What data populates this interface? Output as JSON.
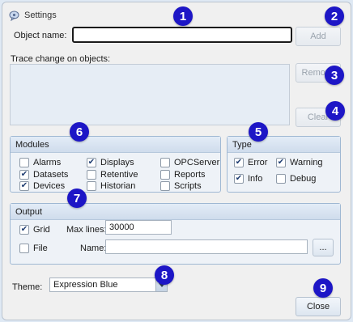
{
  "window": {
    "title": "Settings"
  },
  "object_name": {
    "label": "Object name:",
    "value": "",
    "add_label": "Add"
  },
  "trace": {
    "label": "Trace change on objects:",
    "remove_label": "Remove",
    "clear_label": "Clear"
  },
  "modules": {
    "title": "Modules",
    "items": [
      {
        "label": "Alarms",
        "checked": false
      },
      {
        "label": "Datasets",
        "checked": true
      },
      {
        "label": "Devices",
        "checked": true
      },
      {
        "label": "Displays",
        "checked": true
      },
      {
        "label": "Retentive",
        "checked": false
      },
      {
        "label": "Historian",
        "checked": false
      },
      {
        "label": "OPCServer",
        "checked": false
      },
      {
        "label": "Reports",
        "checked": false
      },
      {
        "label": "Scripts",
        "checked": false
      }
    ]
  },
  "type": {
    "title": "Type",
    "items": [
      {
        "label": "Error",
        "checked": true
      },
      {
        "label": "Warning",
        "checked": true
      },
      {
        "label": "Info",
        "checked": true
      },
      {
        "label": "Debug",
        "checked": false
      }
    ]
  },
  "output": {
    "title": "Output",
    "grid": {
      "label": "Grid",
      "checked": true
    },
    "max_lines_label": "Max lines:",
    "max_lines_value": "30000",
    "file": {
      "label": "File",
      "checked": false
    },
    "name_label": "Name:",
    "name_value": "",
    "browse_label": "..."
  },
  "theme": {
    "label": "Theme:",
    "value": "Expression Blue"
  },
  "close_label": "Close",
  "badges": [
    "1",
    "2",
    "3",
    "4",
    "5",
    "6",
    "7",
    "8",
    "9"
  ],
  "colors": {
    "badge": "#1d16c6",
    "group_header": "#d6e2f0",
    "window_bg": "#f0f0f0"
  }
}
